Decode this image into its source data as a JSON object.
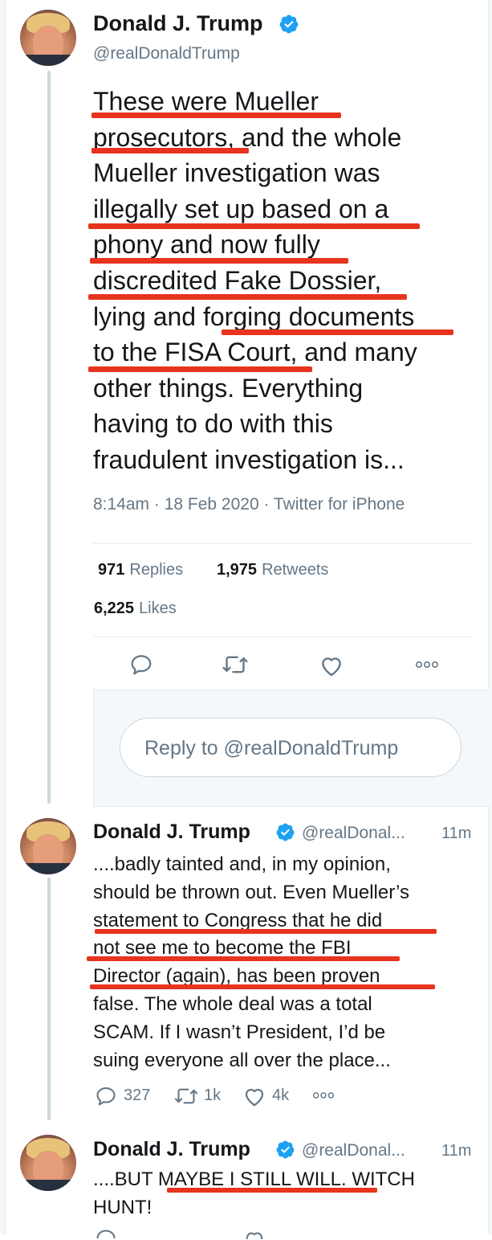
{
  "main_tweet": {
    "author_name": "Donald J. Trump",
    "author_handle": "@realDonaldTrump",
    "verified_color": "#1da1f2",
    "lines": [
      "These were Mueller",
      "prosecutors, and the whole",
      "Mueller investigation was",
      "illegally set up based on a",
      "phony and now fully",
      "discredited Fake Dossier,",
      "lying and forging documents",
      "to the FISA Court, and many",
      "other things. Everything",
      "having to do with this",
      "fraudulent investigation is..."
    ],
    "meta": "8:14am · 18 Feb 2020 · Twitter for iPhone",
    "stats": {
      "replies_count": "971",
      "replies_label": "Replies",
      "retweets_count": "1,975",
      "retweets_label": "Retweets",
      "likes_count": "6,225",
      "likes_label": "Likes"
    },
    "actions": [
      "reply-icon",
      "retweet-icon",
      "like-icon",
      "more-icon"
    ]
  },
  "reply_prompt": {
    "placeholder": "Reply to @realDonaldTrump"
  },
  "thread": [
    {
      "author_name": "Donald J. Trump",
      "author_handle": "@realDonal...",
      "time": "11m",
      "lines": [
        "....badly tainted and, in my opinion,",
        "should be thrown out. Even Mueller’s",
        "statement to Congress that he did",
        "not see me to become the FBI",
        "Director (again), has been proven",
        "false. The whole deal was a total",
        "SCAM. If I wasn’t President, I’d be",
        "suing everyone all over the place..."
      ],
      "reply_count": "327",
      "retweet_count": "1k",
      "like_count": "4k"
    },
    {
      "author_name": "Donald J. Trump",
      "author_handle": "@realDonal...",
      "time": "11m",
      "lines": [
        "....BUT MAYBE I STILL WILL. WITCH",
        "HUNT!"
      ]
    }
  ],
  "colors": {
    "highlight_underline": "#e8331e",
    "secondary_text": "#657786",
    "primary_text": "#14171a"
  }
}
